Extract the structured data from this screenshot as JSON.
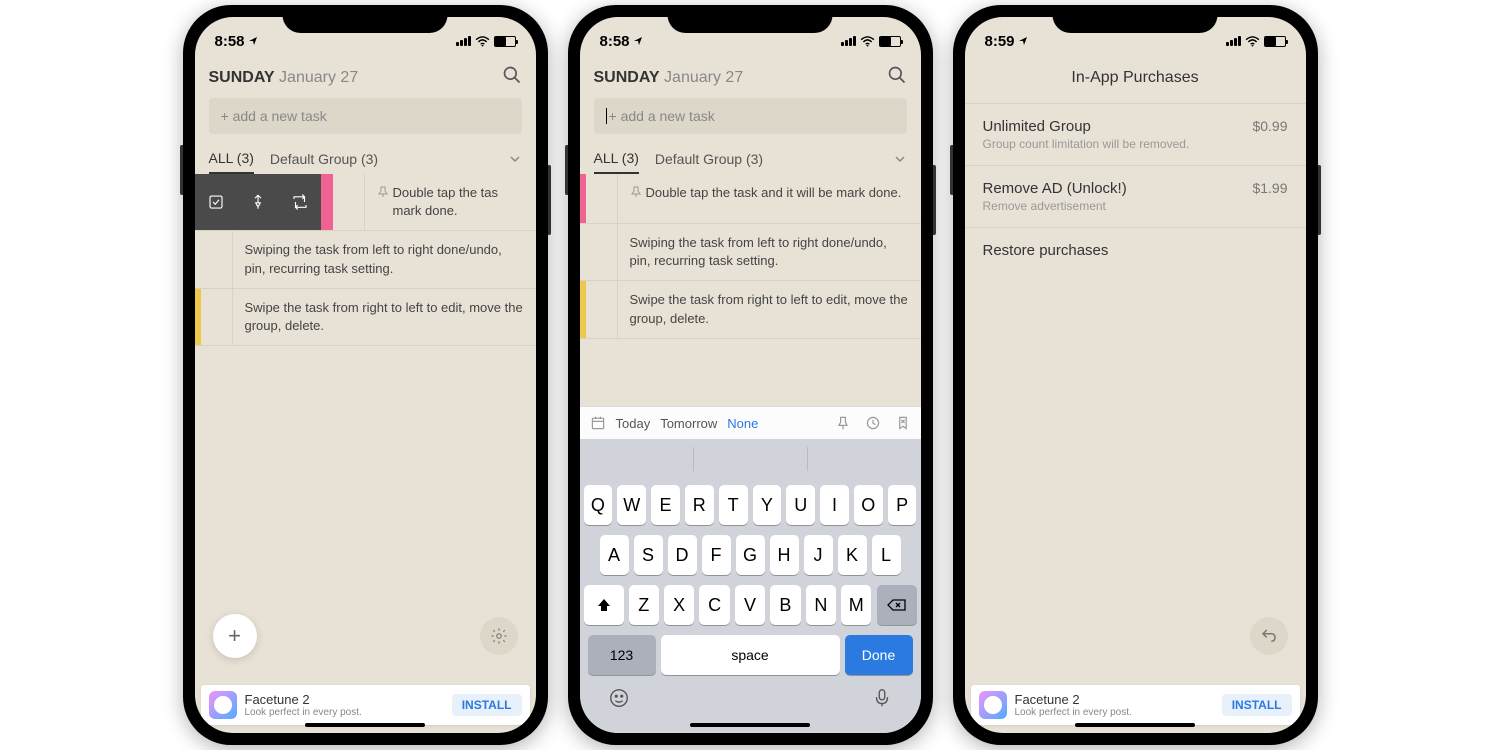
{
  "status": {
    "time1": "8:58",
    "time2": "8:58",
    "time3": "8:59"
  },
  "header": {
    "day": "SUNDAY",
    "date": "January 27"
  },
  "addTask": {
    "placeholder": "+ add a new task"
  },
  "tabs": {
    "all": "ALL (3)",
    "group": "Default Group (3)"
  },
  "tasks": [
    {
      "text": "Double tap the task and it will be mark done.",
      "pinned": true,
      "color": "#f06292"
    },
    {
      "text": "Swiping the task from left to right done/undo, pin, recurring task setting.",
      "pinned": false,
      "color": "transparent"
    },
    {
      "text": "Swipe the task from right to left to edit, move the group, delete.",
      "pinned": false,
      "color": "#ecc94b"
    }
  ],
  "task1_short": "Double tap the tas\nmark done.",
  "ad": {
    "title": "Facetune 2",
    "sub": "Look perfect in every post.",
    "btn": "INSTALL"
  },
  "kb": {
    "today": "Today",
    "tomorrow": "Tomorrow",
    "none": "None",
    "row1": [
      "Q",
      "W",
      "E",
      "R",
      "T",
      "Y",
      "U",
      "I",
      "O",
      "P"
    ],
    "row2": [
      "A",
      "S",
      "D",
      "F",
      "G",
      "H",
      "J",
      "K",
      "L"
    ],
    "row3": [
      "Z",
      "X",
      "C",
      "V",
      "B",
      "N",
      "M"
    ],
    "numKey": "123",
    "space": "space",
    "done": "Done"
  },
  "iap": {
    "title": "In-App Purchases",
    "items": [
      {
        "name": "Unlimited Group",
        "desc": "Group count limitation will be removed.",
        "price": "$0.99"
      },
      {
        "name": "Remove AD (Unlock!)",
        "desc": "Remove advertisement",
        "price": "$1.99"
      }
    ],
    "restore": "Restore purchases"
  }
}
